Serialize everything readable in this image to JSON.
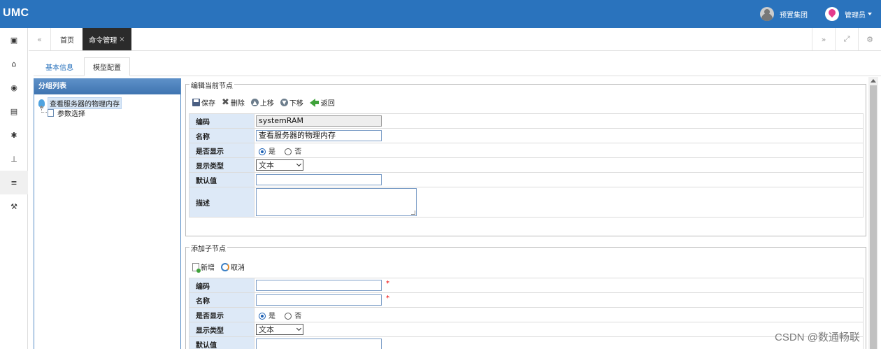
{
  "app": {
    "brand": "UMC"
  },
  "topbar": {
    "org_name": "预置集团",
    "user_name": "管理员"
  },
  "left_icons": [
    {
      "name": "id-card-icon",
      "glyph": "▣"
    },
    {
      "name": "bank-icon",
      "glyph": "⌂"
    },
    {
      "name": "eye-icon",
      "glyph": "◉"
    },
    {
      "name": "server-icon",
      "glyph": "▤"
    },
    {
      "name": "gear-icon",
      "glyph": "✱"
    },
    {
      "name": "sitemap-icon",
      "glyph": "⊥"
    },
    {
      "name": "list-icon",
      "glyph": "≡"
    },
    {
      "name": "wrench-icon",
      "glyph": "⚒"
    }
  ],
  "tabs": {
    "home": "首页",
    "active": "命令管理",
    "close_glyph": "×",
    "nav_left_glyph": "«",
    "nav_right_glyph": "»",
    "fullscreen_glyph": "⤢",
    "settings_glyph": "⚙"
  },
  "subtabs": {
    "basic": "基本信息",
    "model": "模型配置"
  },
  "group_list": {
    "title": "分组列表",
    "nodes": [
      {
        "label": "查看服务器的物理内存",
        "selected": true
      },
      {
        "label": "参数选择",
        "selected": false
      }
    ]
  },
  "edit_node": {
    "legend": "编辑当前节点",
    "toolbar": {
      "save": "保存",
      "delete": "删除",
      "up": "上移",
      "down": "下移",
      "back": "返回"
    },
    "fields": {
      "code_label": "编码",
      "code_value": "systemRAM",
      "name_label": "名称",
      "name_value": "查看服务器的物理内存",
      "show_label": "是否显示",
      "yes": "是",
      "no": "否",
      "type_label": "显示类型",
      "type_value": "文本",
      "default_label": "默认值",
      "default_value": "",
      "desc_label": "描述"
    }
  },
  "add_child": {
    "legend": "添加子节点",
    "toolbar": {
      "add": "新增",
      "cancel": "取消"
    },
    "fields": {
      "code_label": "编码",
      "name_label": "名称",
      "show_label": "是否显示",
      "yes": "是",
      "no": "否",
      "type_label": "显示类型",
      "type_value": "文本",
      "default_label": "默认值",
      "required_mark": "*"
    }
  },
  "watermark": "CSDN @数通畅联"
}
